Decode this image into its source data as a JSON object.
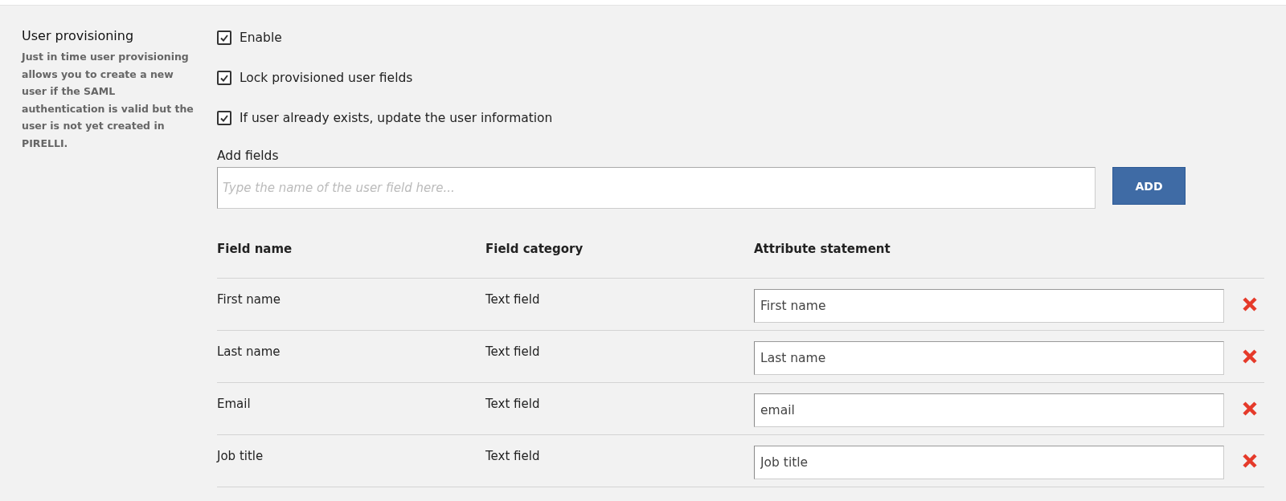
{
  "section": {
    "title": "User provisioning",
    "description": "Just in time user provisioning allows you to create a new user if the SAML authentication is valid but the user is not yet created in PIRELLI."
  },
  "options": [
    {
      "label": "Enable",
      "checked": true
    },
    {
      "label": "Lock provisioned user fields",
      "checked": true
    },
    {
      "label": "If user already exists, update the user information",
      "checked": true
    }
  ],
  "add_field": {
    "label": "Add fields",
    "placeholder": "Type the name of the user field here...",
    "button": "ADD"
  },
  "table": {
    "columns": [
      "Field name",
      "Field category",
      "Attribute statement"
    ],
    "rows": [
      {
        "name": "First name",
        "category": "Text field",
        "attribute": "First name"
      },
      {
        "name": "Last name",
        "category": "Text field",
        "attribute": "Last name"
      },
      {
        "name": "Email",
        "category": "Text field",
        "attribute": "email"
      },
      {
        "name": "Job title",
        "category": "Text field",
        "attribute": "Job title"
      }
    ]
  }
}
